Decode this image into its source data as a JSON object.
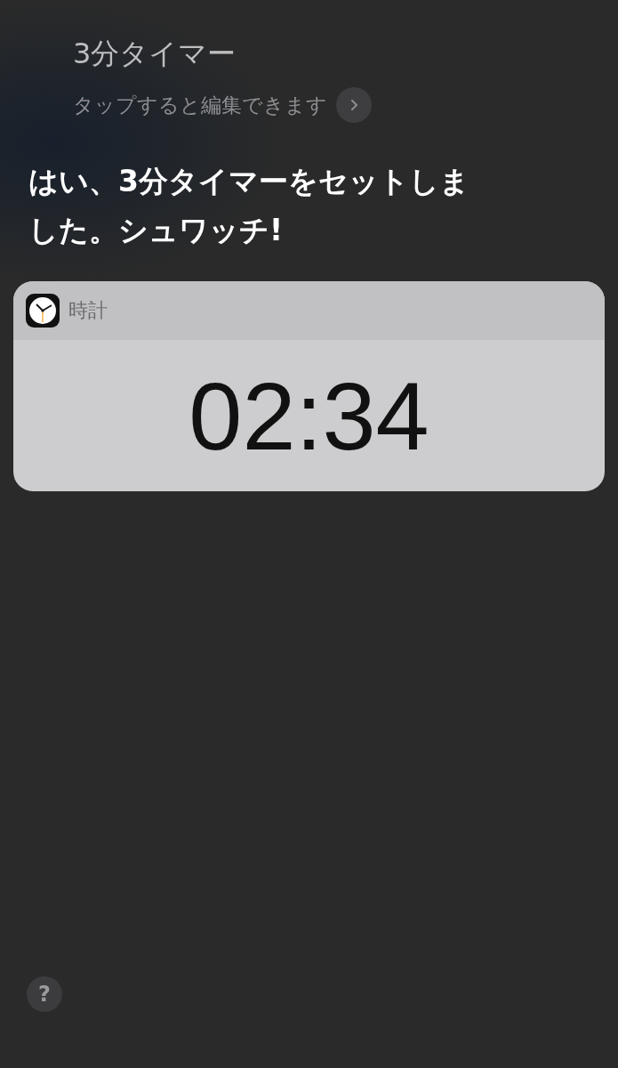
{
  "query": {
    "text": "3分タイマー",
    "hint": "タップすると編集できます"
  },
  "response": "はい、3分タイマーをセットしました。シュワッチ!",
  "card": {
    "app_name": "時計",
    "timer": "02:34"
  },
  "help_button": "?"
}
